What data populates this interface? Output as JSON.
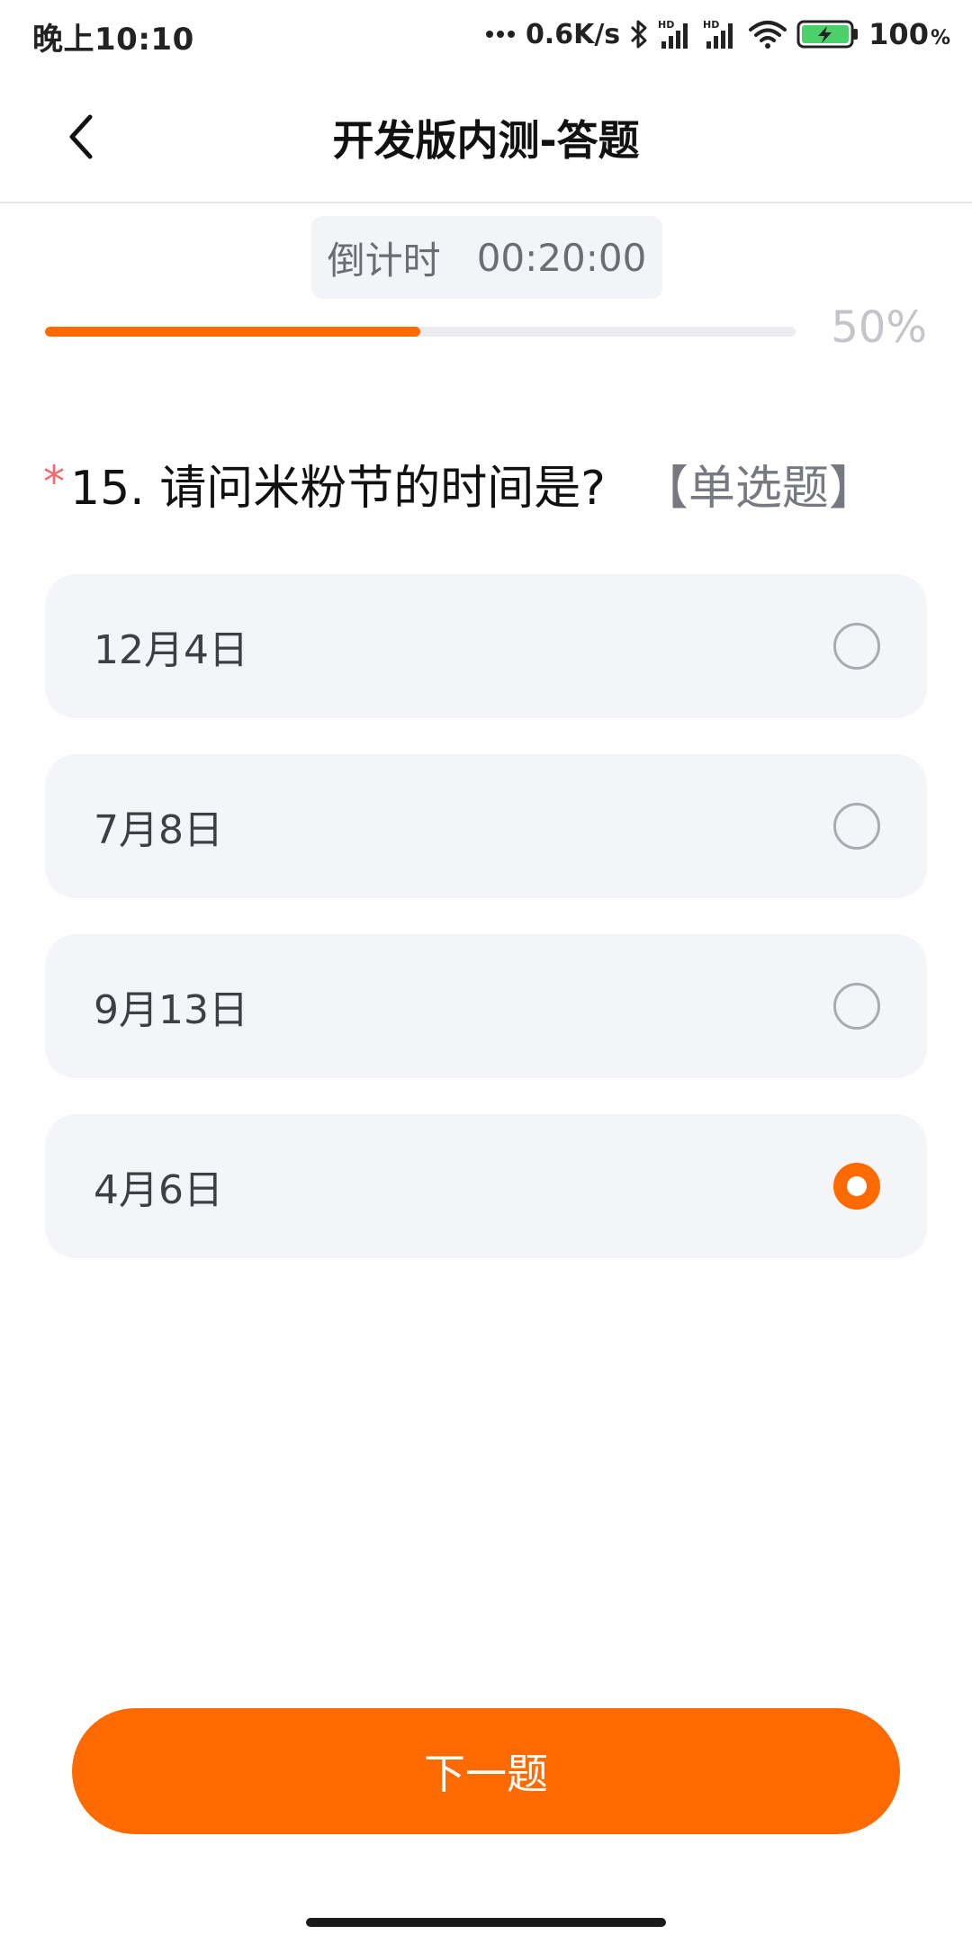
{
  "status_bar": {
    "time": "晚上10:10",
    "network_speed": "0.6K/s",
    "battery": "100",
    "battery_unit": "%",
    "signal_label_1": "HD",
    "signal_label_2": "HD"
  },
  "header": {
    "title": "开发版内测-答题"
  },
  "countdown": {
    "label": "倒计时",
    "value": "00:20:00"
  },
  "progress": {
    "percent_text": "50%",
    "fraction": 0.5
  },
  "question": {
    "required_mark": "*",
    "text": "15. 请问米粉节的时间是?",
    "type": "【单选题】"
  },
  "options": [
    {
      "label": "12月4日",
      "selected": false
    },
    {
      "label": "7月8日",
      "selected": false
    },
    {
      "label": "9月13日",
      "selected": false
    },
    {
      "label": "4月6日",
      "selected": true
    }
  ],
  "next_button": {
    "label": "下一题"
  },
  "colors": {
    "accent": "#ff6a00",
    "required": "#f26a6a"
  }
}
